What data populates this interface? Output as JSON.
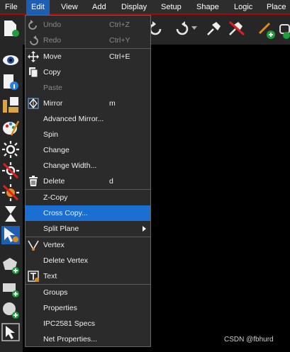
{
  "menubar": {
    "items": [
      {
        "label": "File"
      },
      {
        "label": "Edit"
      },
      {
        "label": "View"
      },
      {
        "label": "Add"
      },
      {
        "label": "Display"
      },
      {
        "label": "Setup"
      },
      {
        "label": "Shape"
      },
      {
        "label": "Logic"
      },
      {
        "label": "Place"
      }
    ],
    "active": "Edit"
  },
  "edit_menu": {
    "items": [
      {
        "label": "Undo",
        "shortcut": "Ctrl+Z",
        "enabled": false,
        "icon": "undo-icon"
      },
      {
        "label": "Redo",
        "shortcut": "Ctrl+Y",
        "enabled": false,
        "icon": "redo-icon"
      },
      {
        "label": "Move",
        "shortcut": "Ctrl+E",
        "enabled": true,
        "icon": "move-icon"
      },
      {
        "label": "Copy",
        "shortcut": "",
        "enabled": true,
        "icon": "copy-icon"
      },
      {
        "label": "Paste",
        "shortcut": "",
        "enabled": false,
        "icon": ""
      },
      {
        "label": "Mirror",
        "shortcut": "m",
        "enabled": true,
        "icon": "mirror-icon"
      },
      {
        "label": "Advanced Mirror...",
        "shortcut": "",
        "enabled": true,
        "icon": ""
      },
      {
        "label": "Spin",
        "shortcut": "",
        "enabled": true,
        "icon": ""
      },
      {
        "label": "Change",
        "shortcut": "",
        "enabled": true,
        "icon": ""
      },
      {
        "label": "Change Width...",
        "shortcut": "",
        "enabled": true,
        "icon": ""
      },
      {
        "label": "Delete",
        "shortcut": "d",
        "enabled": true,
        "icon": "trash-icon"
      },
      {
        "label": "Z-Copy",
        "shortcut": "",
        "enabled": true,
        "icon": ""
      },
      {
        "label": "Cross Copy...",
        "shortcut": "",
        "enabled": true,
        "icon": "",
        "highlighted": true
      },
      {
        "label": "Split Plane",
        "shortcut": "",
        "enabled": true,
        "icon": "",
        "submenu": true
      },
      {
        "label": "Vertex",
        "shortcut": "",
        "enabled": true,
        "icon": "vertex-icon"
      },
      {
        "label": "Delete Vertex",
        "shortcut": "",
        "enabled": true,
        "icon": ""
      },
      {
        "label": "Text",
        "shortcut": "",
        "enabled": true,
        "icon": "text-icon"
      },
      {
        "label": "Groups",
        "shortcut": "",
        "enabled": true,
        "icon": ""
      },
      {
        "label": "Properties",
        "shortcut": "",
        "enabled": true,
        "icon": ""
      },
      {
        "label": "IPC2581 Specs",
        "shortcut": "",
        "enabled": true,
        "icon": ""
      },
      {
        "label": "Net Properties...",
        "shortcut": "",
        "enabled": true,
        "icon": ""
      }
    ]
  },
  "watermark": "CSDN @fbhurd",
  "colors": {
    "menubar_bg": "#2d2d2d",
    "menu_active": "#1f5fb3",
    "highlight": "#1a6fd1",
    "menu_bg": "#2b2b2b",
    "accent_red": "#b30000"
  }
}
